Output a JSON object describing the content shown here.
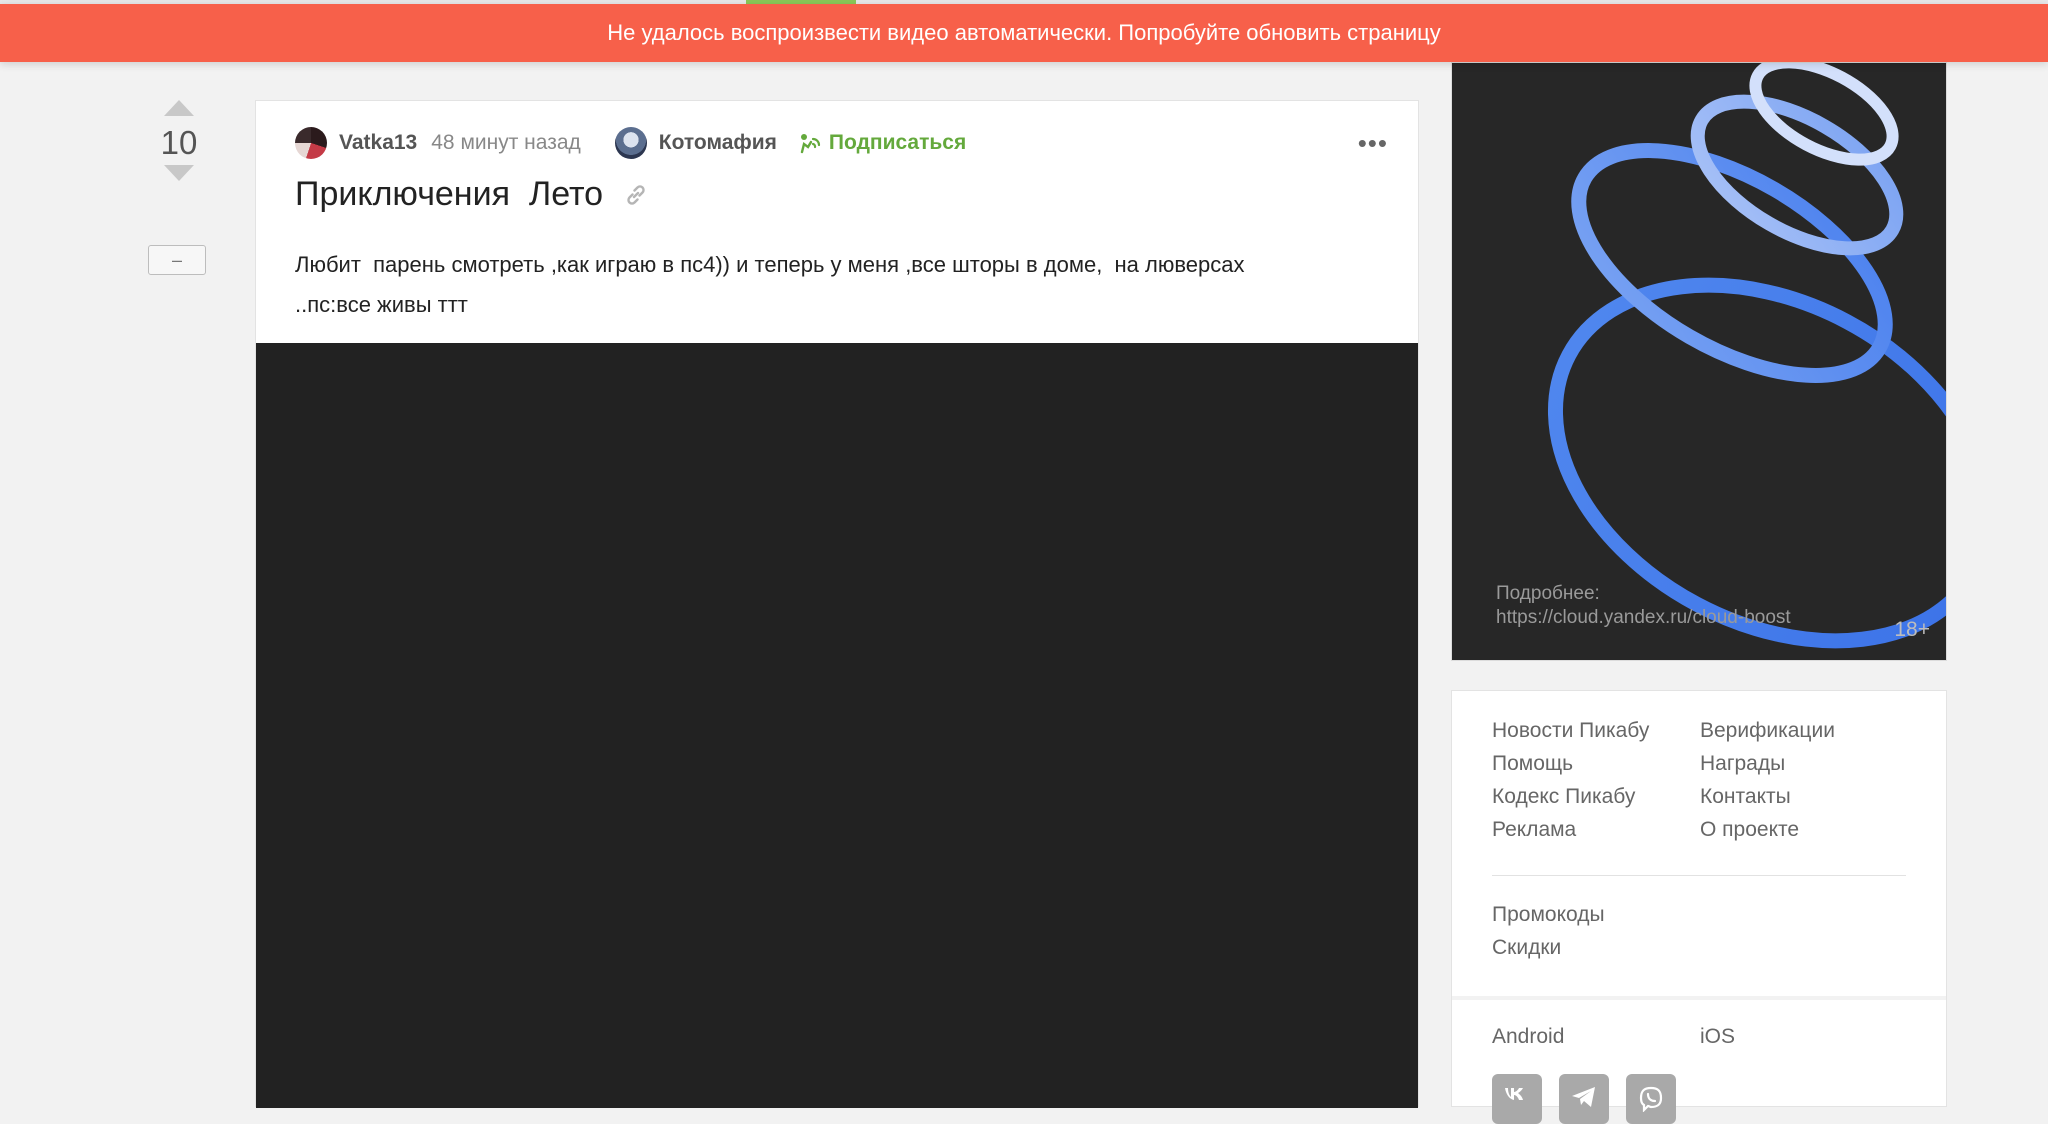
{
  "banner": {
    "message": "Не удалось воспроизвести видео автоматически. Попробуйте обновить страницу"
  },
  "rating": {
    "count": "10",
    "collapse_label": "–"
  },
  "story": {
    "author": "Vatka13",
    "time": "48 минут назад",
    "community": "Котомафия",
    "subscribe_label": "Подписаться",
    "more_label": "•••",
    "title": "Приключения  Лето",
    "text": "Любит  парень смотреть ,как играю в пс4)) и теперь у меня ,все шторы в доме,  на люверсах\n..пс:все живы ттт"
  },
  "ad": {
    "caption_line1": "Подробнее:",
    "caption_line2": "https://cloud.yandex.ru/cloud-boost",
    "age": "18+"
  },
  "sidebar_links": {
    "col1": [
      "Новости Пикабу",
      "Помощь",
      "Кодекс Пикабу",
      "Реклама"
    ],
    "col2": [
      "Верификации",
      "Награды",
      "Контакты",
      "О проекте"
    ],
    "secondary": [
      "Промокоды",
      "Скидки"
    ],
    "apps": [
      "Android",
      "iOS"
    ]
  },
  "social_icons": [
    "vk-icon",
    "telegram-icon",
    "viber-icon"
  ],
  "colors": {
    "banner": "#f7604a",
    "accent_green": "#64a93c",
    "video_bg": "#222222"
  }
}
